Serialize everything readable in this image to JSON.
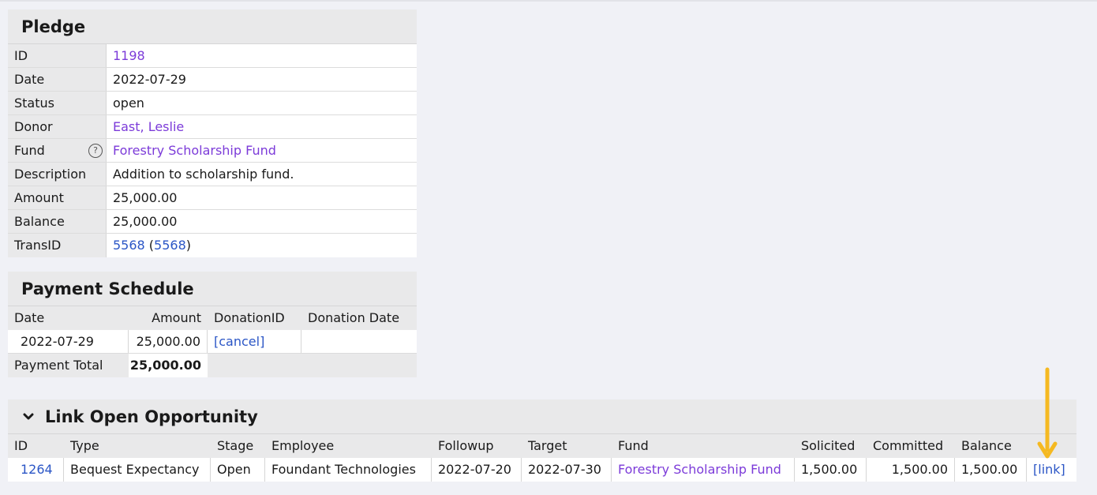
{
  "pledge": {
    "title": "Pledge",
    "rows": [
      {
        "key": "ID",
        "value": "1198",
        "kind": "purple"
      },
      {
        "key": "Date",
        "value": "2022-07-29",
        "kind": "plain"
      },
      {
        "key": "Status",
        "value": "open",
        "kind": "plain"
      },
      {
        "key": "Donor",
        "value": "East, Leslie",
        "kind": "purple"
      },
      {
        "key": "Fund",
        "value": "Forestry Scholarship Fund",
        "kind": "purple"
      },
      {
        "key": "Description",
        "value": "Addition to scholarship fund.",
        "kind": "plain"
      },
      {
        "key": "Amount",
        "value": "25,000.00",
        "kind": "plain"
      },
      {
        "key": "Balance",
        "value": "25,000.00",
        "kind": "plain"
      },
      {
        "key": "TransID",
        "link1": "5568",
        "open_paren": " (",
        "link2": "5568",
        "close_paren": ")"
      }
    ],
    "fund_help_icon": "?"
  },
  "schedule": {
    "title": "Payment Schedule",
    "headers": {
      "date": "Date",
      "amount": "Amount",
      "donation_id": "DonationID",
      "donation_date": "Donation Date"
    },
    "row": {
      "date": "2022-07-29",
      "amount": "25,000.00",
      "action": "[cancel]",
      "donation_date": ""
    },
    "total_label": "Payment Total",
    "total_value": "25,000.00"
  },
  "opportunity": {
    "title": "Link Open Opportunity",
    "headers": {
      "id": "ID",
      "type": "Type",
      "stage": "Stage",
      "employee": "Employee",
      "followup": "Followup",
      "target": "Target",
      "fund": "Fund",
      "solicited": "Solicited",
      "committed": "Committed",
      "balance": "Balance"
    },
    "row": {
      "id": "1264",
      "type": "Bequest Expectancy",
      "stage": "Open",
      "employee": "Foundant Technologies",
      "followup": "2022-07-20",
      "target": "2022-07-30",
      "fund": "Forestry Scholarship Fund",
      "solicited": "1,500.00",
      "committed": "1,500.00",
      "balance": "1,500.00",
      "action": "[link]"
    }
  },
  "colors": {
    "link": "#2b56c6",
    "purple_link": "#7c3bd9",
    "arrow": "#f5b921",
    "panel": "#e9e9ea"
  }
}
